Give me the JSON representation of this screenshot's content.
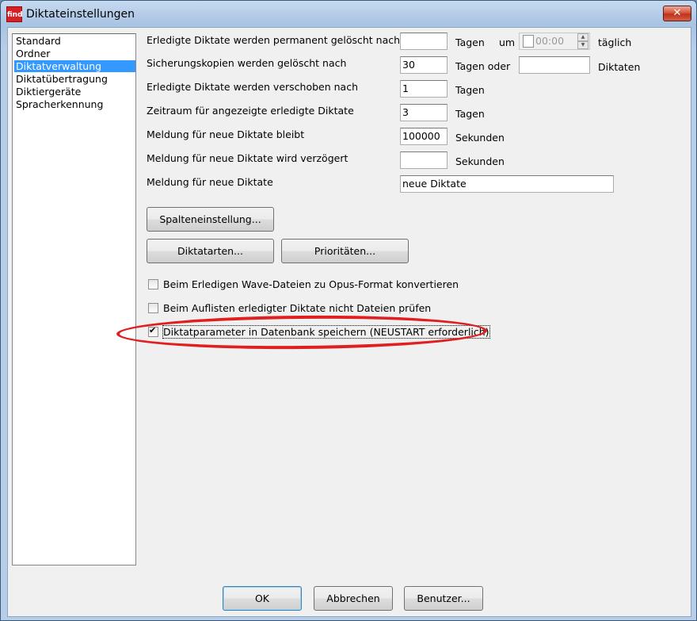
{
  "window": {
    "title": "Diktateinstellungen",
    "app_icon_text": "find",
    "close_glyph": "✕"
  },
  "nav": {
    "items": [
      {
        "label": "Standard",
        "selected": false
      },
      {
        "label": "Ordner",
        "selected": false
      },
      {
        "label": "Diktatverwaltung",
        "selected": true
      },
      {
        "label": "Diktatübertragung",
        "selected": false
      },
      {
        "label": "Diktiergeräte",
        "selected": false
      },
      {
        "label": "Spracherkennung",
        "selected": false
      }
    ]
  },
  "settings": {
    "deleted_permanent": {
      "label": "Erledigte Diktate werden permanent gelöscht nach:",
      "value": "",
      "unit": "Tagen",
      "at_label": "um",
      "time_value": "00:00",
      "daily_label": "täglich"
    },
    "backup_deleted": {
      "label": "Sicherungskopien werden gelöscht nach",
      "value": "30",
      "unit": "Tagen oder",
      "count_value": "",
      "count_unit": "Diktaten"
    },
    "moved_after": {
      "label": "Erledigte Diktate werden verschoben nach",
      "value": "1",
      "unit": "Tagen"
    },
    "display_period": {
      "label": "Zeitraum für angezeigte erledigte Diktate",
      "value": "3",
      "unit": "Tagen"
    },
    "notify_stays": {
      "label": "Meldung für neue Diktate bleibt",
      "value": "100000",
      "unit": "Sekunden"
    },
    "notify_delay": {
      "label": "Meldung für neue Diktate wird verzögert",
      "value": "",
      "unit": "Sekunden"
    },
    "notify_text": {
      "label": "Meldung für neue Diktate",
      "value": "neue Diktate"
    }
  },
  "buttons": {
    "columns": "Spalteneinstellung...",
    "types": "Diktatarten...",
    "priorities": "Prioritäten...",
    "ok": "OK",
    "cancel": "Abbrechen",
    "user": "Benutzer..."
  },
  "checkboxes": [
    {
      "label": "Beim Erledigen Wave-Dateien zu Opus-Format konvertieren",
      "checked": false
    },
    {
      "label": "Beim Auflisten erledigter Diktate nicht Dateien prüfen",
      "checked": false
    },
    {
      "label": "Diktatparameter in Datenbank speichern (NEUSTART erforderlich)",
      "checked": true
    }
  ],
  "colors": {
    "selection": "#3399ff",
    "annotation": "#e02020",
    "close_button": "#c1311b"
  }
}
